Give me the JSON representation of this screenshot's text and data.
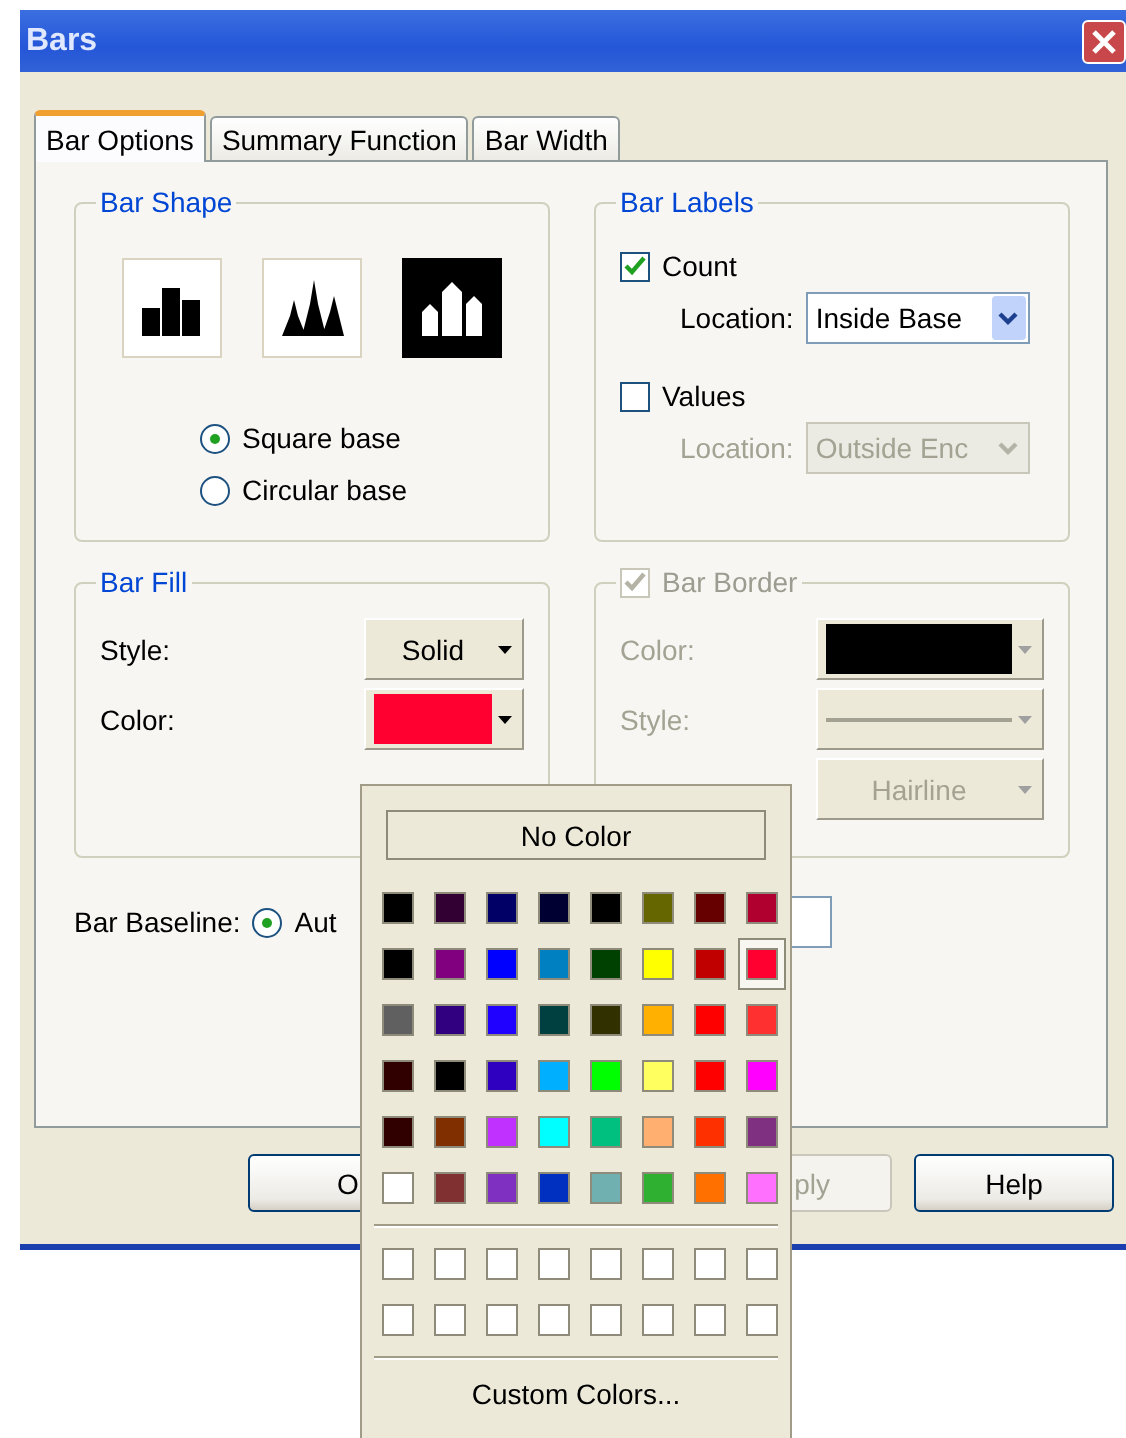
{
  "window": {
    "title": "Bars"
  },
  "tabs": [
    {
      "label": "Bar Options",
      "selected": true
    },
    {
      "label": "Summary Function",
      "selected": false
    },
    {
      "label": "Bar Width",
      "selected": false
    }
  ],
  "bar_shape": {
    "title": "Bar Shape",
    "shapes": [
      {
        "kind": "flat",
        "selected": false
      },
      {
        "kind": "spiked",
        "selected": false
      },
      {
        "kind": "gabled",
        "selected": true
      }
    ],
    "bases": [
      {
        "label": "Square base",
        "selected": true
      },
      {
        "label": "Circular base",
        "selected": false
      }
    ]
  },
  "bar_labels": {
    "title": "Bar Labels",
    "options": [
      {
        "label": "Count",
        "checked": true,
        "location_label": "Location:",
        "location": "Inside Base",
        "disabled": false
      },
      {
        "label": "Values",
        "checked": false,
        "location_label": "Location:",
        "location": "Outside Enc",
        "disabled": true
      }
    ]
  },
  "bar_fill": {
    "title": "Bar Fill",
    "style_label": "Style:",
    "style": "Solid",
    "color_label": "Color:",
    "color": "#ff0030"
  },
  "bar_border": {
    "title": "Bar Border",
    "checked": true,
    "disabled": true,
    "color_label": "Color:",
    "color": "#000000",
    "style_label": "Style:",
    "width": "Hairline"
  },
  "baseline": {
    "label": "Bar Baseline:",
    "option": "Aut",
    "selected": true
  },
  "buttons": [
    {
      "label": "O",
      "disabled": false
    },
    {
      "label": "ply",
      "disabled": true
    },
    {
      "label": "Help",
      "disabled": false
    }
  ],
  "color_popup": {
    "no_color": "No Color",
    "swatches": [
      [
        {
          "color": "#000000",
          "selected": false
        },
        {
          "color": "#330033",
          "selected": false
        },
        {
          "color": "#000066",
          "selected": false
        },
        {
          "color": "#000033",
          "selected": false
        },
        {
          "color": "#000000",
          "selected": false
        },
        {
          "color": "#666600",
          "selected": false
        },
        {
          "color": "#660000",
          "selected": false
        },
        {
          "color": "#b00030",
          "selected": false
        }
      ],
      [
        {
          "color": "#000000",
          "selected": false
        },
        {
          "color": "#800080",
          "selected": false
        },
        {
          "color": "#0000ff",
          "selected": false
        },
        {
          "color": "#0080c0",
          "selected": false
        },
        {
          "color": "#004000",
          "selected": false
        },
        {
          "color": "#ffff00",
          "selected": false
        },
        {
          "color": "#c00000",
          "selected": false
        },
        {
          "color": "#ff0030",
          "selected": true
        }
      ],
      [
        {
          "color": "#606060",
          "selected": false
        },
        {
          "color": "#300080",
          "selected": false
        },
        {
          "color": "#2000ff",
          "selected": false
        },
        {
          "color": "#004040",
          "selected": false
        },
        {
          "color": "#303000",
          "selected": false
        },
        {
          "color": "#ffb000",
          "selected": false
        },
        {
          "color": "#ff0000",
          "selected": false
        },
        {
          "color": "#ff3030",
          "selected": false
        }
      ],
      [
        {
          "color": "#300000",
          "selected": false
        },
        {
          "color": "#000000",
          "selected": false
        },
        {
          "color": "#3000c0",
          "selected": false
        },
        {
          "color": "#00b0ff",
          "selected": false
        },
        {
          "color": "#00ff00",
          "selected": false
        },
        {
          "color": "#ffff60",
          "selected": false
        },
        {
          "color": "#ff0000",
          "selected": false
        },
        {
          "color": "#ff00ff",
          "selected": false
        }
      ],
      [
        {
          "color": "#300000",
          "selected": false
        },
        {
          "color": "#803000",
          "selected": false
        },
        {
          "color": "#c030ff",
          "selected": false
        },
        {
          "color": "#00ffff",
          "selected": false
        },
        {
          "color": "#00c080",
          "selected": false
        },
        {
          "color": "#ffb070",
          "selected": false
        },
        {
          "color": "#ff3000",
          "selected": false
        },
        {
          "color": "#803080",
          "selected": false
        }
      ],
      [
        {
          "color": "#ffffff",
          "selected": false
        },
        {
          "color": "#803030",
          "selected": false
        },
        {
          "color": "#8030c0",
          "selected": false
        },
        {
          "color": "#0030c0",
          "selected": false
        },
        {
          "color": "#70b0b0",
          "selected": false
        },
        {
          "color": "#30b030",
          "selected": false
        },
        {
          "color": "#ff7000",
          "selected": false
        },
        {
          "color": "#ff70ff",
          "selected": false
        }
      ]
    ],
    "custom_swatches": [
      [
        {
          "color": "#ffffff",
          "selected": false
        },
        {
          "color": "#ffffff",
          "selected": false
        },
        {
          "color": "#ffffff",
          "selected": false
        },
        {
          "color": "#ffffff",
          "selected": false
        },
        {
          "color": "#ffffff",
          "selected": false
        },
        {
          "color": "#ffffff",
          "selected": false
        },
        {
          "color": "#ffffff",
          "selected": false
        },
        {
          "color": "#ffffff",
          "selected": false
        }
      ],
      [
        {
          "color": "#ffffff",
          "selected": false
        },
        {
          "color": "#ffffff",
          "selected": false
        },
        {
          "color": "#ffffff",
          "selected": false
        },
        {
          "color": "#ffffff",
          "selected": false
        },
        {
          "color": "#ffffff",
          "selected": false
        },
        {
          "color": "#ffffff",
          "selected": false
        },
        {
          "color": "#ffffff",
          "selected": false
        },
        {
          "color": "#ffffff",
          "selected": false
        }
      ]
    ],
    "custom_colors": "Custom Colors..."
  }
}
